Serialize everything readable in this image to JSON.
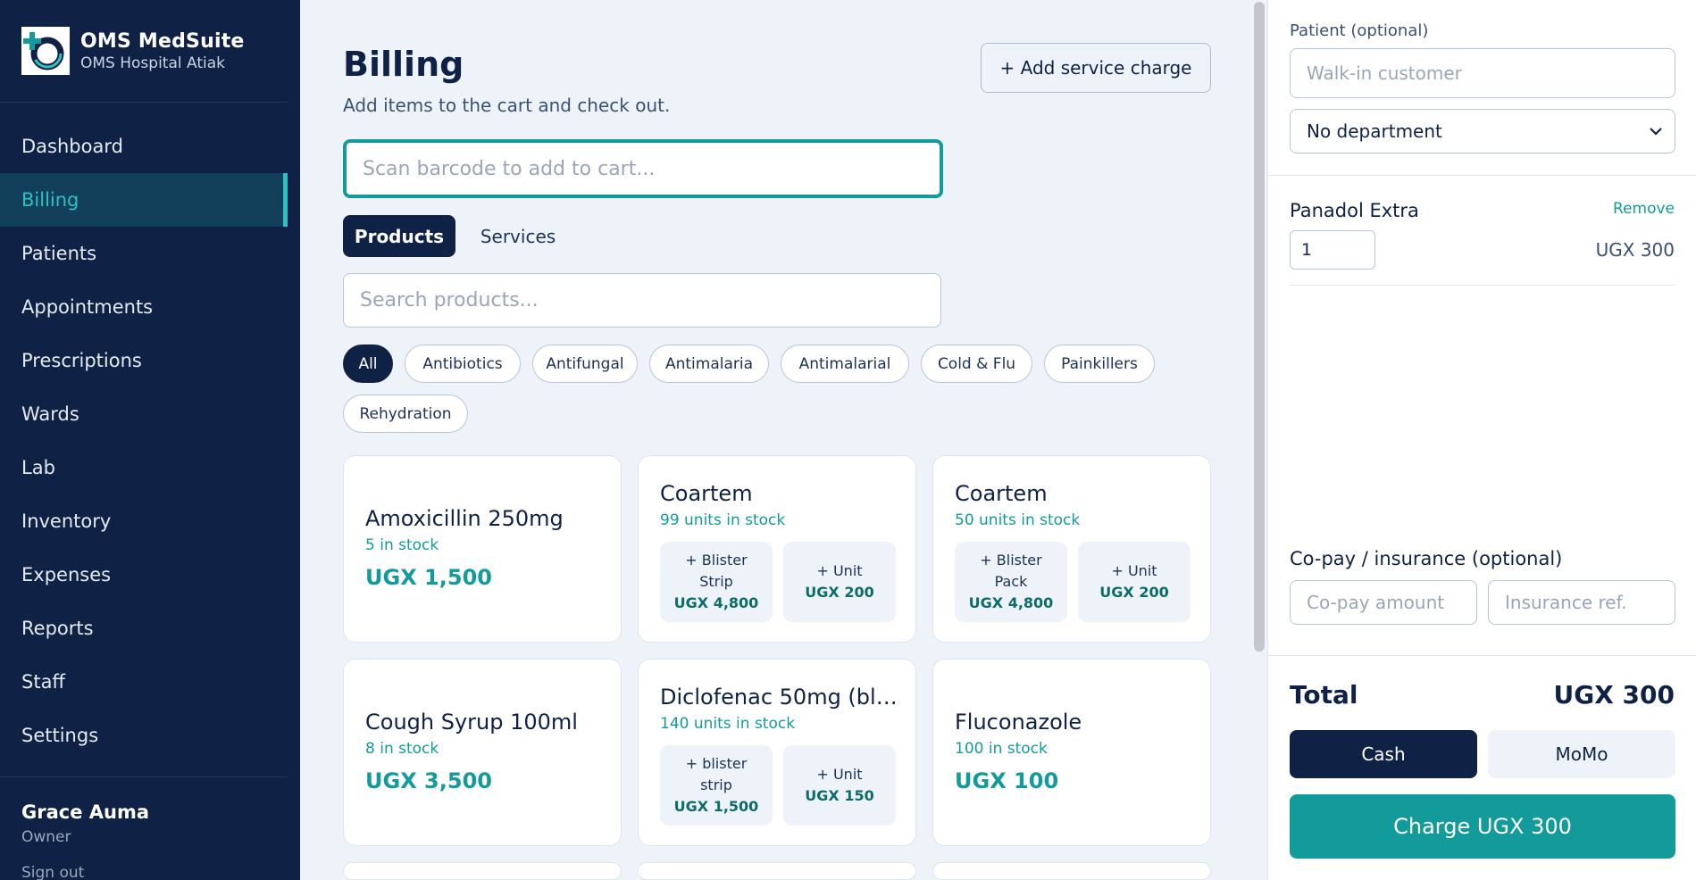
{
  "brand": {
    "name": "OMS MedSuite",
    "subtitle": "OMS Hospital Atiak"
  },
  "nav": {
    "items": [
      "Dashboard",
      "Billing",
      "Patients",
      "Appointments",
      "Prescriptions",
      "Wards",
      "Lab",
      "Inventory",
      "Expenses",
      "Reports",
      "Staff",
      "Settings"
    ],
    "active": "Billing"
  },
  "user": {
    "name": "Grace Auma",
    "role": "Owner",
    "signout": "Sign out"
  },
  "page": {
    "title": "Billing",
    "subtitle": "Add items to the cart and check out.",
    "add_service_label": "+ Add service charge",
    "scan_placeholder": "Scan barcode to add to cart...",
    "search_placeholder": "Search products..."
  },
  "tabs": {
    "products": "Products",
    "services": "Services",
    "active": "Products"
  },
  "categories": [
    "All",
    "Antibiotics",
    "Antifungal",
    "Antimalaria",
    "Antimalarial",
    "Cold & Flu",
    "Painkillers",
    "Rehydration"
  ],
  "products": [
    {
      "name": "Amoxicillin 250mg",
      "stock": "5 in stock",
      "price": "UGX 1,500"
    },
    {
      "name": "Coartem",
      "stock": "99 units in stock",
      "units": [
        {
          "label_1": "+ Blister",
          "label_2": "Strip",
          "price": "UGX 4,800"
        },
        {
          "label_1": "+ Unit",
          "label_2": "",
          "price": "UGX 200"
        }
      ]
    },
    {
      "name": "Coartem",
      "stock": "50 units in stock",
      "units": [
        {
          "label_1": "+ Blister",
          "label_2": "Pack",
          "price": "UGX 4,800"
        },
        {
          "label_1": "+ Unit",
          "label_2": "",
          "price": "UGX 200"
        }
      ]
    },
    {
      "name": "Cough Syrup 100ml",
      "stock": "8 in stock",
      "price": "UGX 3,500"
    },
    {
      "name": "Diclofenac 50mg (blis...",
      "stock": "140 units in stock",
      "units": [
        {
          "label_1": "+ blister",
          "label_2": "strip",
          "price": "UGX 1,500"
        },
        {
          "label_1": "+ Unit",
          "label_2": "",
          "price": "UGX 150"
        }
      ]
    },
    {
      "name": "Fluconazole",
      "stock": "100 in stock",
      "price": "UGX 100"
    }
  ],
  "checkout": {
    "patient_label": "Patient (optional)",
    "patient_placeholder": "Walk-in customer",
    "department_value": "No department",
    "cart": [
      {
        "name": "Panadol Extra",
        "remove": "Remove",
        "qty": "1",
        "price": "UGX 300"
      }
    ],
    "copay_label": "Co-pay / insurance (optional)",
    "copay_placeholder": "Co-pay amount",
    "insurance_placeholder": "Insurance ref.",
    "total_label": "Total",
    "total_value": "UGX 300",
    "cash_label": "Cash",
    "momo_label": "MoMo",
    "charge_label": "Charge UGX 300"
  },
  "colors": {
    "navy": "#0f2246",
    "teal": "#139b9b",
    "accent": "#2dc1c1",
    "background": "#eef3f9"
  }
}
